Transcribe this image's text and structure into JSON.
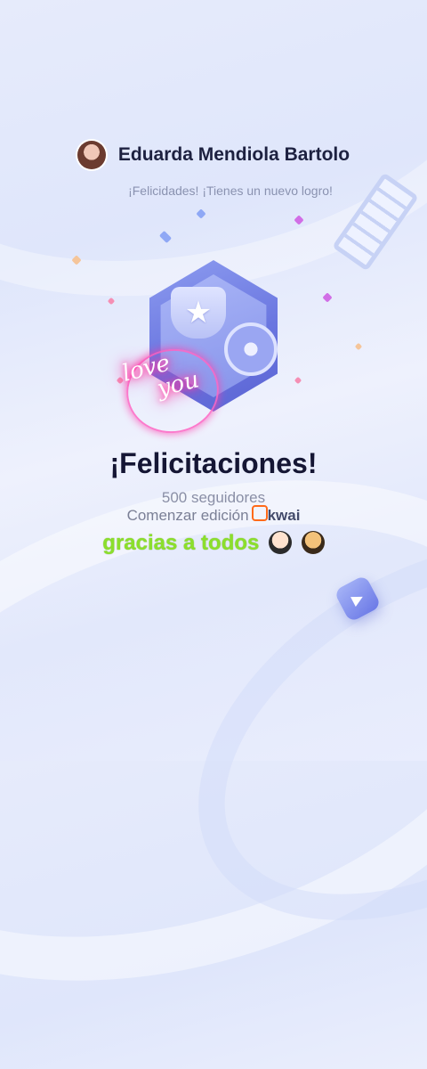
{
  "header": {
    "user_name": "Eduarda Mendiola Bartolo",
    "subtitle": "¡Felicidades! ¡Tienes un nuevo logro!"
  },
  "badge": {
    "neon_text_1": "love",
    "neon_text_2": "you"
  },
  "achievement": {
    "title": "¡Felicitaciones!",
    "followers": "500 seguidores",
    "edit_prefix": "Comenzar edición",
    "brand": "kwai"
  },
  "caption": {
    "text": "gracias a todos"
  },
  "colors": {
    "title": "#151634",
    "caption": "#8bdf2c",
    "brand_accent": "#ff6a1a"
  }
}
